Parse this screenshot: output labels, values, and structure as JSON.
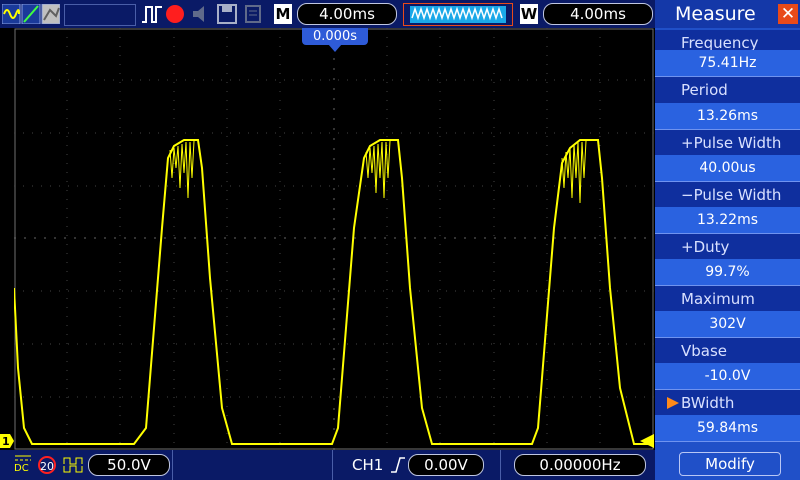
{
  "top": {
    "m_label": "M",
    "timebase": "4.00ms",
    "w_label": "W",
    "window_timebase": "4.00ms",
    "trigger_position": "0.000s"
  },
  "panel": {
    "title": "Measure",
    "items": [
      {
        "label": "Frequency",
        "value": "75.41Hz"
      },
      {
        "label": "Period",
        "value": "13.26ms"
      },
      {
        "label": "+Pulse Width",
        "value": "40.00us"
      },
      {
        "label": "−Pulse Width",
        "value": "13.22ms"
      },
      {
        "label": "+Duty",
        "value": "99.7%"
      },
      {
        "label": "Maximum",
        "value": "302V"
      },
      {
        "label": "Vbase",
        "value": "-10.0V"
      },
      {
        "label": "BWidth",
        "value": "59.84ms"
      }
    ],
    "modify_label": "Modify"
  },
  "bottom": {
    "coupling": "DC",
    "bw_limit": "20",
    "volts_div": "50.0V",
    "trigger_source": "CH1",
    "trigger_level": "0.00V",
    "frequency": "0.00000Hz"
  },
  "channel_marker": "1",
  "colors": {
    "trace": "#ffff00",
    "panel": "#2050c8",
    "accent": "#e84a1a"
  }
}
